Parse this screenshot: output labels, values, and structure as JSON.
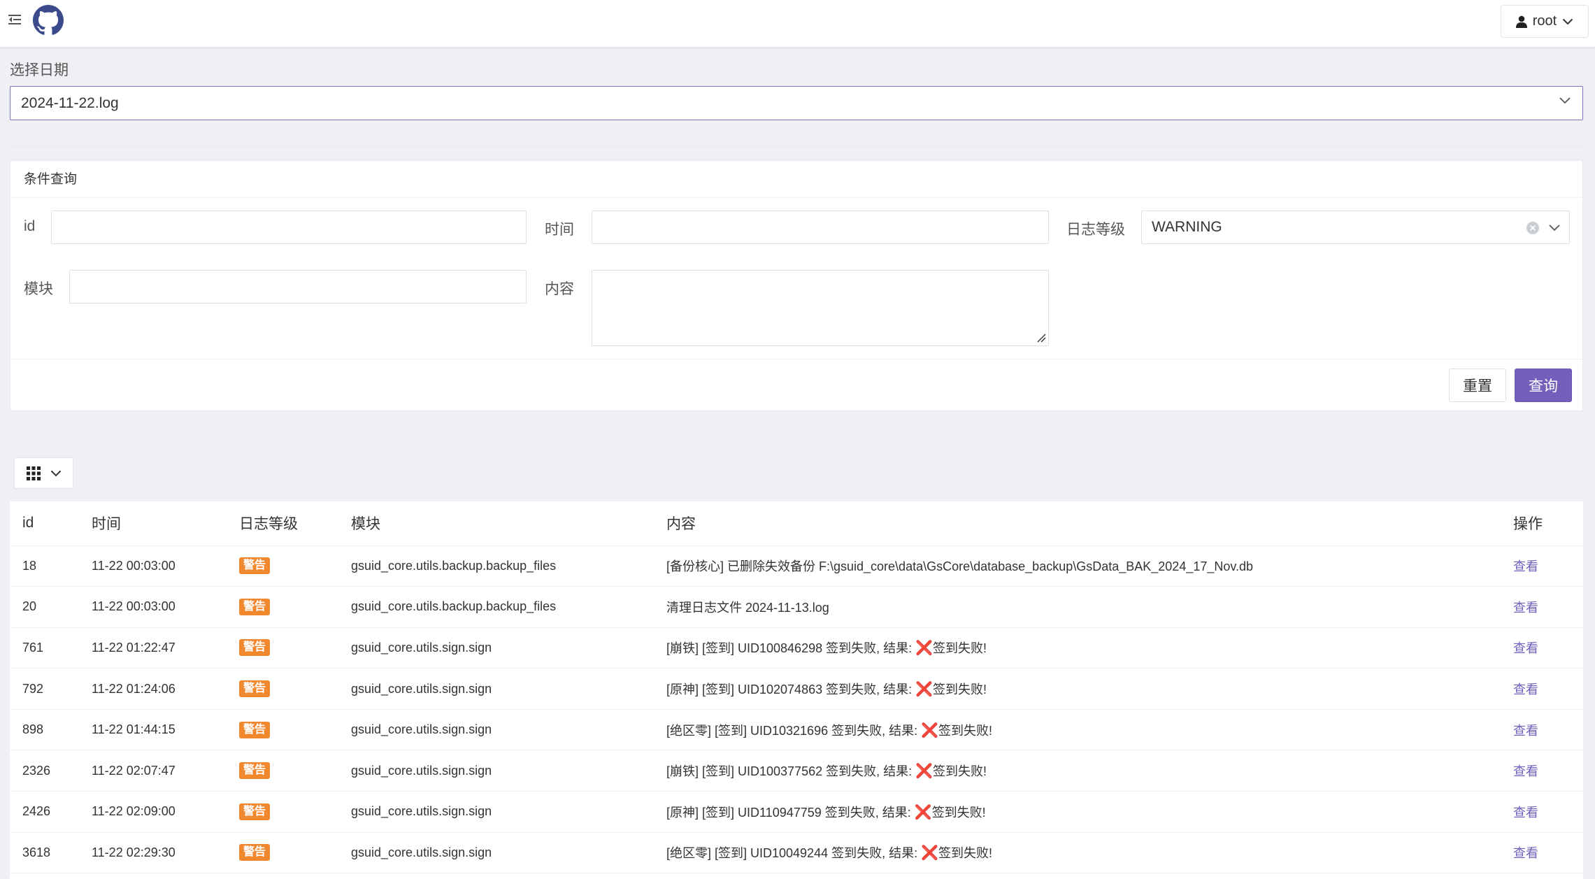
{
  "user": {
    "name": "root"
  },
  "date_picker": {
    "label": "选择日期",
    "value": "2024-11-22.log"
  },
  "query": {
    "title": "条件查询",
    "fields": {
      "id": {
        "label": "id",
        "value": ""
      },
      "time": {
        "label": "时间",
        "value": ""
      },
      "level": {
        "label": "日志等级",
        "value": "WARNING"
      },
      "module": {
        "label": "模块",
        "value": ""
      },
      "content": {
        "label": "内容",
        "value": ""
      }
    },
    "reset_label": "重置",
    "search_label": "查询"
  },
  "table": {
    "headers": {
      "id": "id",
      "time": "时间",
      "level": "日志等级",
      "module": "模块",
      "content": "内容",
      "action": "操作"
    },
    "rows": [
      {
        "id": "18",
        "time": "11-22 00:03:00",
        "level": "警告",
        "module": "gsuid_core.utils.backup.backup_files",
        "content": "[备份核心] 已删除失效备份 F:\\gsuid_core\\data\\GsCore\\database_backup\\GsData_BAK_2024_17_Nov.db",
        "x_mark": "",
        "content_tail": "",
        "action": "查看"
      },
      {
        "id": "20",
        "time": "11-22 00:03:00",
        "level": "警告",
        "module": "gsuid_core.utils.backup.backup_files",
        "content": "清理日志文件 2024-11-13.log",
        "x_mark": "",
        "content_tail": "",
        "action": "查看"
      },
      {
        "id": "761",
        "time": "11-22 01:22:47",
        "level": "警告",
        "module": "gsuid_core.utils.sign.sign",
        "content": "[崩铁] [签到] UID100846298 签到失败, 结果: ",
        "x_mark": "❌",
        "content_tail": "签到失败!",
        "action": "查看"
      },
      {
        "id": "792",
        "time": "11-22 01:24:06",
        "level": "警告",
        "module": "gsuid_core.utils.sign.sign",
        "content": "[原神] [签到] UID102074863 签到失败, 结果: ",
        "x_mark": "❌",
        "content_tail": "签到失败!",
        "action": "查看"
      },
      {
        "id": "898",
        "time": "11-22 01:44:15",
        "level": "警告",
        "module": "gsuid_core.utils.sign.sign",
        "content": "[绝区零] [签到] UID10321696 签到失败, 结果: ",
        "x_mark": "❌",
        "content_tail": "签到失败!",
        "action": "查看"
      },
      {
        "id": "2326",
        "time": "11-22 02:07:47",
        "level": "警告",
        "module": "gsuid_core.utils.sign.sign",
        "content": "[崩铁] [签到] UID100377562 签到失败, 结果: ",
        "x_mark": "❌",
        "content_tail": "签到失败!",
        "action": "查看"
      },
      {
        "id": "2426",
        "time": "11-22 02:09:00",
        "level": "警告",
        "module": "gsuid_core.utils.sign.sign",
        "content": "[原神] [签到] UID110947759 签到失败, 结果: ",
        "x_mark": "❌",
        "content_tail": "签到失败!",
        "action": "查看"
      },
      {
        "id": "3618",
        "time": "11-22 02:29:30",
        "level": "警告",
        "module": "gsuid_core.utils.sign.sign",
        "content": "[绝区零] [签到] UID10049244 签到失败, 结果: ",
        "x_mark": "❌",
        "content_tail": "签到失败!",
        "action": "查看"
      }
    ]
  },
  "icons": {
    "menu_toggle": "menu-fold-icon",
    "logo": "github-icon",
    "user": "user-icon",
    "chevron": "chevron-down-icon",
    "clear": "clear-circle-icon",
    "columns": "grid-icon"
  },
  "colors": {
    "primary": "#7360bb",
    "badge_warning": "#f0882f",
    "fail_mark": "#e8373f"
  }
}
